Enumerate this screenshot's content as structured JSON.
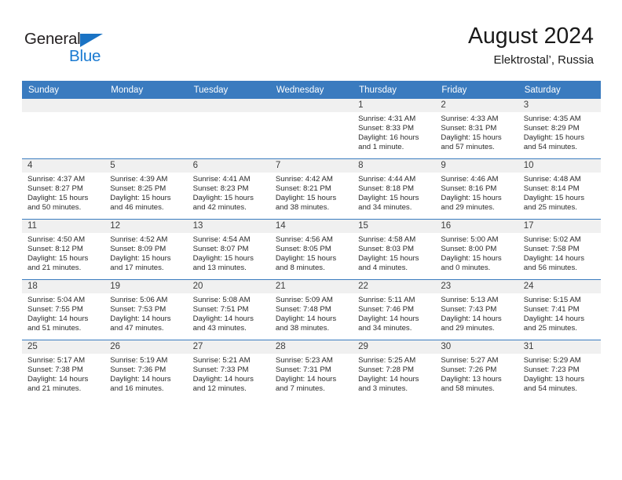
{
  "brand": {
    "name_part1": "General",
    "name_part2": "Blue",
    "accent_color": "#1a7ad1"
  },
  "header": {
    "title": "August 2024",
    "subtitle": "Elektrostal’, Russia"
  },
  "theme": {
    "header_row_color": "#3a7bbf",
    "daynum_band_color": "#f0f0f0",
    "text_color": "#2b2b2b"
  },
  "weekdays": [
    "Sunday",
    "Monday",
    "Tuesday",
    "Wednesday",
    "Thursday",
    "Friday",
    "Saturday"
  ],
  "weeks": [
    [
      {
        "day": "",
        "empty": true,
        "sunrise": "",
        "sunset": "",
        "daylight_line1": "",
        "daylight_line2": ""
      },
      {
        "day": "",
        "empty": true,
        "sunrise": "",
        "sunset": "",
        "daylight_line1": "",
        "daylight_line2": ""
      },
      {
        "day": "",
        "empty": true,
        "sunrise": "",
        "sunset": "",
        "daylight_line1": "",
        "daylight_line2": ""
      },
      {
        "day": "",
        "empty": true,
        "sunrise": "",
        "sunset": "",
        "daylight_line1": "",
        "daylight_line2": ""
      },
      {
        "day": "1",
        "empty": false,
        "sunrise": "Sunrise: 4:31 AM",
        "sunset": "Sunset: 8:33 PM",
        "daylight_line1": "Daylight: 16 hours",
        "daylight_line2": "and 1 minute."
      },
      {
        "day": "2",
        "empty": false,
        "sunrise": "Sunrise: 4:33 AM",
        "sunset": "Sunset: 8:31 PM",
        "daylight_line1": "Daylight: 15 hours",
        "daylight_line2": "and 57 minutes."
      },
      {
        "day": "3",
        "empty": false,
        "sunrise": "Sunrise: 4:35 AM",
        "sunset": "Sunset: 8:29 PM",
        "daylight_line1": "Daylight: 15 hours",
        "daylight_line2": "and 54 minutes."
      }
    ],
    [
      {
        "day": "4",
        "empty": false,
        "sunrise": "Sunrise: 4:37 AM",
        "sunset": "Sunset: 8:27 PM",
        "daylight_line1": "Daylight: 15 hours",
        "daylight_line2": "and 50 minutes."
      },
      {
        "day": "5",
        "empty": false,
        "sunrise": "Sunrise: 4:39 AM",
        "sunset": "Sunset: 8:25 PM",
        "daylight_line1": "Daylight: 15 hours",
        "daylight_line2": "and 46 minutes."
      },
      {
        "day": "6",
        "empty": false,
        "sunrise": "Sunrise: 4:41 AM",
        "sunset": "Sunset: 8:23 PM",
        "daylight_line1": "Daylight: 15 hours",
        "daylight_line2": "and 42 minutes."
      },
      {
        "day": "7",
        "empty": false,
        "sunrise": "Sunrise: 4:42 AM",
        "sunset": "Sunset: 8:21 PM",
        "daylight_line1": "Daylight: 15 hours",
        "daylight_line2": "and 38 minutes."
      },
      {
        "day": "8",
        "empty": false,
        "sunrise": "Sunrise: 4:44 AM",
        "sunset": "Sunset: 8:18 PM",
        "daylight_line1": "Daylight: 15 hours",
        "daylight_line2": "and 34 minutes."
      },
      {
        "day": "9",
        "empty": false,
        "sunrise": "Sunrise: 4:46 AM",
        "sunset": "Sunset: 8:16 PM",
        "daylight_line1": "Daylight: 15 hours",
        "daylight_line2": "and 29 minutes."
      },
      {
        "day": "10",
        "empty": false,
        "sunrise": "Sunrise: 4:48 AM",
        "sunset": "Sunset: 8:14 PM",
        "daylight_line1": "Daylight: 15 hours",
        "daylight_line2": "and 25 minutes."
      }
    ],
    [
      {
        "day": "11",
        "empty": false,
        "sunrise": "Sunrise: 4:50 AM",
        "sunset": "Sunset: 8:12 PM",
        "daylight_line1": "Daylight: 15 hours",
        "daylight_line2": "and 21 minutes."
      },
      {
        "day": "12",
        "empty": false,
        "sunrise": "Sunrise: 4:52 AM",
        "sunset": "Sunset: 8:09 PM",
        "daylight_line1": "Daylight: 15 hours",
        "daylight_line2": "and 17 minutes."
      },
      {
        "day": "13",
        "empty": false,
        "sunrise": "Sunrise: 4:54 AM",
        "sunset": "Sunset: 8:07 PM",
        "daylight_line1": "Daylight: 15 hours",
        "daylight_line2": "and 13 minutes."
      },
      {
        "day": "14",
        "empty": false,
        "sunrise": "Sunrise: 4:56 AM",
        "sunset": "Sunset: 8:05 PM",
        "daylight_line1": "Daylight: 15 hours",
        "daylight_line2": "and 8 minutes."
      },
      {
        "day": "15",
        "empty": false,
        "sunrise": "Sunrise: 4:58 AM",
        "sunset": "Sunset: 8:03 PM",
        "daylight_line1": "Daylight: 15 hours",
        "daylight_line2": "and 4 minutes."
      },
      {
        "day": "16",
        "empty": false,
        "sunrise": "Sunrise: 5:00 AM",
        "sunset": "Sunset: 8:00 PM",
        "daylight_line1": "Daylight: 15 hours",
        "daylight_line2": "and 0 minutes."
      },
      {
        "day": "17",
        "empty": false,
        "sunrise": "Sunrise: 5:02 AM",
        "sunset": "Sunset: 7:58 PM",
        "daylight_line1": "Daylight: 14 hours",
        "daylight_line2": "and 56 minutes."
      }
    ],
    [
      {
        "day": "18",
        "empty": false,
        "sunrise": "Sunrise: 5:04 AM",
        "sunset": "Sunset: 7:55 PM",
        "daylight_line1": "Daylight: 14 hours",
        "daylight_line2": "and 51 minutes."
      },
      {
        "day": "19",
        "empty": false,
        "sunrise": "Sunrise: 5:06 AM",
        "sunset": "Sunset: 7:53 PM",
        "daylight_line1": "Daylight: 14 hours",
        "daylight_line2": "and 47 minutes."
      },
      {
        "day": "20",
        "empty": false,
        "sunrise": "Sunrise: 5:08 AM",
        "sunset": "Sunset: 7:51 PM",
        "daylight_line1": "Daylight: 14 hours",
        "daylight_line2": "and 43 minutes."
      },
      {
        "day": "21",
        "empty": false,
        "sunrise": "Sunrise: 5:09 AM",
        "sunset": "Sunset: 7:48 PM",
        "daylight_line1": "Daylight: 14 hours",
        "daylight_line2": "and 38 minutes."
      },
      {
        "day": "22",
        "empty": false,
        "sunrise": "Sunrise: 5:11 AM",
        "sunset": "Sunset: 7:46 PM",
        "daylight_line1": "Daylight: 14 hours",
        "daylight_line2": "and 34 minutes."
      },
      {
        "day": "23",
        "empty": false,
        "sunrise": "Sunrise: 5:13 AM",
        "sunset": "Sunset: 7:43 PM",
        "daylight_line1": "Daylight: 14 hours",
        "daylight_line2": "and 29 minutes."
      },
      {
        "day": "24",
        "empty": false,
        "sunrise": "Sunrise: 5:15 AM",
        "sunset": "Sunset: 7:41 PM",
        "daylight_line1": "Daylight: 14 hours",
        "daylight_line2": "and 25 minutes."
      }
    ],
    [
      {
        "day": "25",
        "empty": false,
        "sunrise": "Sunrise: 5:17 AM",
        "sunset": "Sunset: 7:38 PM",
        "daylight_line1": "Daylight: 14 hours",
        "daylight_line2": "and 21 minutes."
      },
      {
        "day": "26",
        "empty": false,
        "sunrise": "Sunrise: 5:19 AM",
        "sunset": "Sunset: 7:36 PM",
        "daylight_line1": "Daylight: 14 hours",
        "daylight_line2": "and 16 minutes."
      },
      {
        "day": "27",
        "empty": false,
        "sunrise": "Sunrise: 5:21 AM",
        "sunset": "Sunset: 7:33 PM",
        "daylight_line1": "Daylight: 14 hours",
        "daylight_line2": "and 12 minutes."
      },
      {
        "day": "28",
        "empty": false,
        "sunrise": "Sunrise: 5:23 AM",
        "sunset": "Sunset: 7:31 PM",
        "daylight_line1": "Daylight: 14 hours",
        "daylight_line2": "and 7 minutes."
      },
      {
        "day": "29",
        "empty": false,
        "sunrise": "Sunrise: 5:25 AM",
        "sunset": "Sunset: 7:28 PM",
        "daylight_line1": "Daylight: 14 hours",
        "daylight_line2": "and 3 minutes."
      },
      {
        "day": "30",
        "empty": false,
        "sunrise": "Sunrise: 5:27 AM",
        "sunset": "Sunset: 7:26 PM",
        "daylight_line1": "Daylight: 13 hours",
        "daylight_line2": "and 58 minutes."
      },
      {
        "day": "31",
        "empty": false,
        "sunrise": "Sunrise: 5:29 AM",
        "sunset": "Sunset: 7:23 PM",
        "daylight_line1": "Daylight: 13 hours",
        "daylight_line2": "and 54 minutes."
      }
    ]
  ]
}
